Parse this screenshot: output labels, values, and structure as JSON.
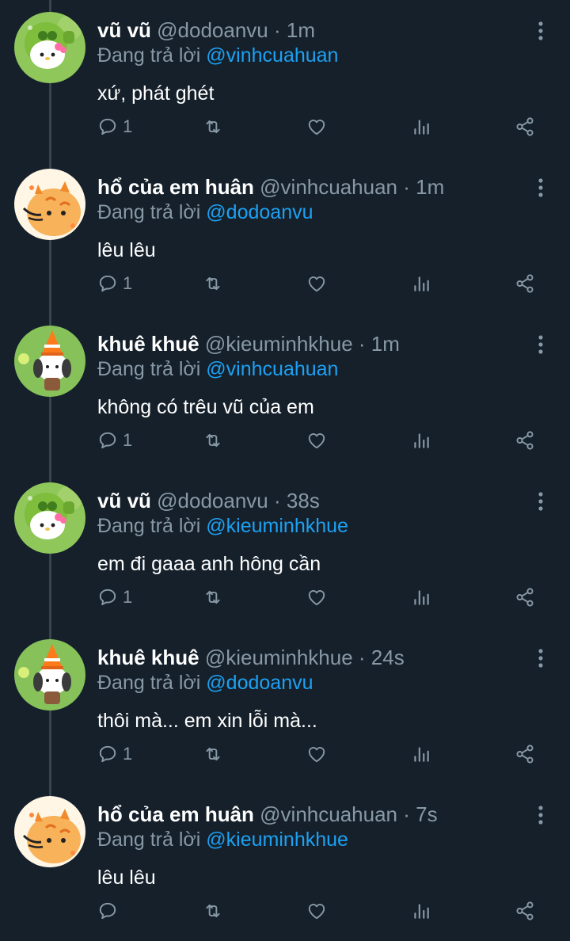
{
  "colors": {
    "background": "#15202b",
    "text_primary": "#ffffff",
    "text_secondary": "#8899a6",
    "mention": "#1da1f2",
    "thread_line": "#38444d"
  },
  "tweets": [
    {
      "name": "vũ vũ",
      "handle": "@dodoanvu",
      "sep": "·",
      "time": "1m",
      "reply_prefix": "Đang trả lời",
      "reply_to": "@vinhcuahuan",
      "text": "xứ, phát ghét",
      "reply_count": "1",
      "avatar": "hello-kitty-peashooter-avatar"
    },
    {
      "name": "hổ của em huân",
      "handle": "@vinhcuahuan",
      "sep": "·",
      "time": "1m",
      "reply_prefix": "Đang trả lời",
      "reply_to": "@dodoanvu",
      "text": "lêu lêu",
      "reply_count": "1",
      "avatar": "cartoon-tiger-avatar"
    },
    {
      "name": "khuê khuê",
      "handle": "@kieuminhkhue",
      "sep": "·",
      "time": "1m",
      "reply_prefix": "Đang trả lời",
      "reply_to": "@vinhcuahuan",
      "text": "không có trêu vũ của em",
      "reply_count": "1",
      "avatar": "pochacco-cone-avatar"
    },
    {
      "name": "vũ vũ",
      "handle": "@dodoanvu",
      "sep": "·",
      "time": "38s",
      "reply_prefix": "Đang trả lời",
      "reply_to": "@kieuminhkhue",
      "text": "em đi gaaa anh hông cần",
      "reply_count": "1",
      "avatar": "hello-kitty-peashooter-avatar"
    },
    {
      "name": "khuê khuê",
      "handle": "@kieuminhkhue",
      "sep": "·",
      "time": "24s",
      "reply_prefix": "Đang trả lời",
      "reply_to": "@dodoanvu",
      "text": "thôi mà... em xin lỗi mà...",
      "reply_count": "1",
      "avatar": "pochacco-cone-avatar"
    },
    {
      "name": "hổ của em huân",
      "handle": "@vinhcuahuan",
      "sep": "·",
      "time": "7s",
      "reply_prefix": "Đang trả lời",
      "reply_to": "@kieuminhkhue",
      "text": "lêu lêu",
      "reply_count": "",
      "avatar": "cartoon-tiger-avatar"
    }
  ]
}
